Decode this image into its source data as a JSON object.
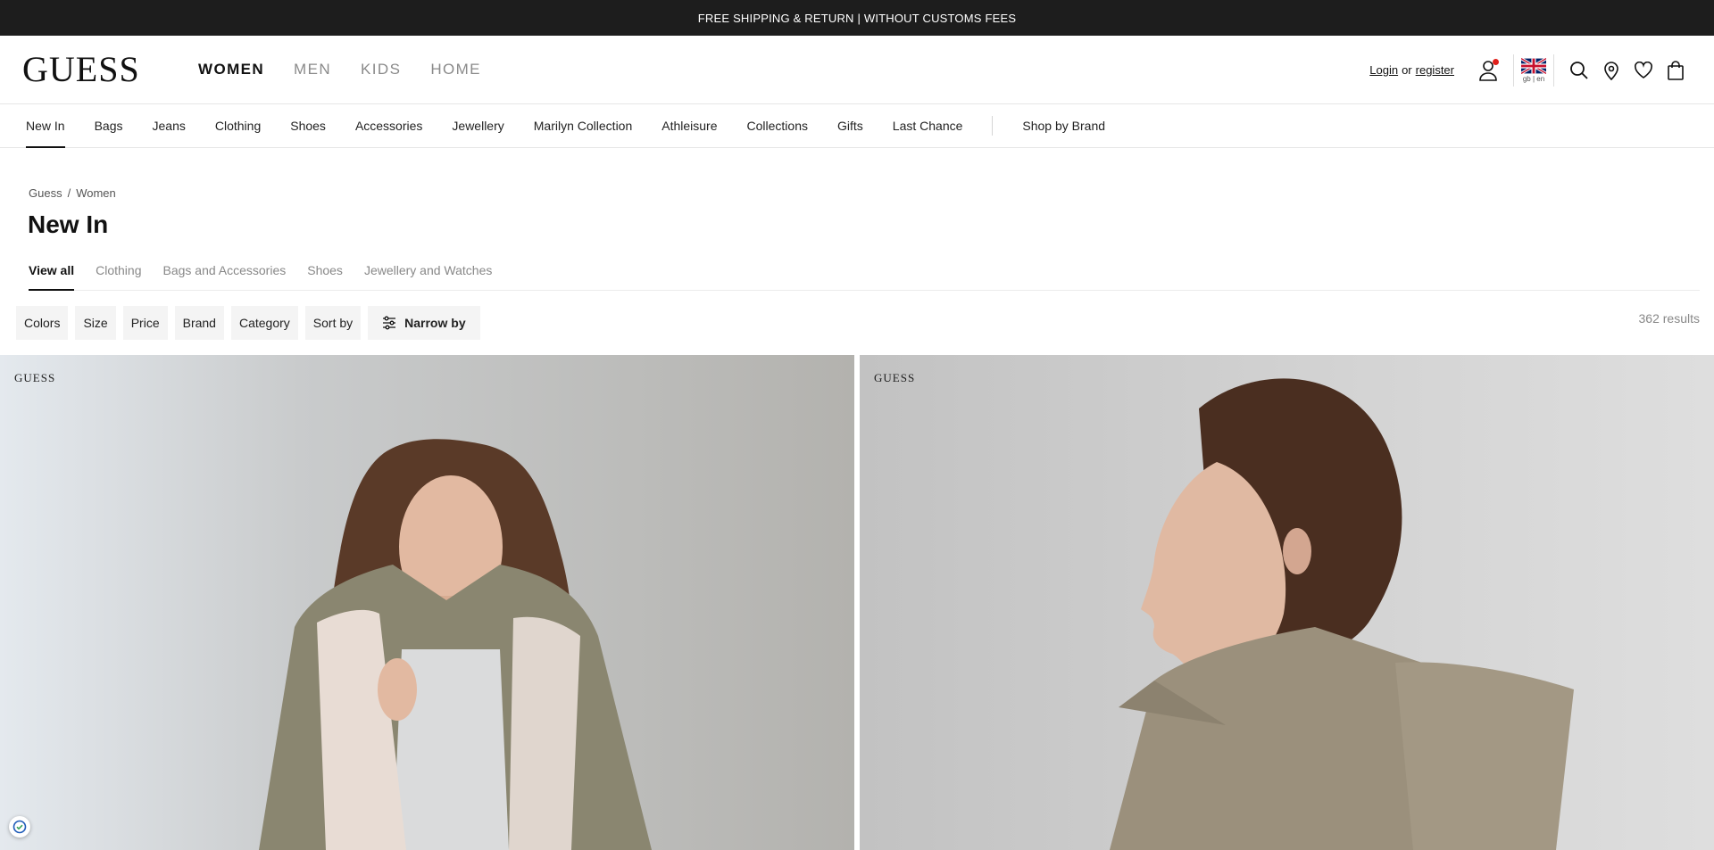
{
  "topbar": {
    "text": "FREE SHIPPING & RETURN | WITHOUT CUSTOMS FEES"
  },
  "header": {
    "logo": "GUESS",
    "main_nav": [
      "WOMEN",
      "MEN",
      "KIDS",
      "HOME"
    ],
    "login": {
      "login_label": "Login",
      "or": "or",
      "register_label": "register"
    },
    "locale": "gb | en"
  },
  "subnav": {
    "items": [
      "New In",
      "Bags",
      "Jeans",
      "Clothing",
      "Shoes",
      "Accessories",
      "Jewellery",
      "Marilyn Collection",
      "Athleisure",
      "Collections",
      "Gifts",
      "Last Chance"
    ],
    "shop_by_brand": "Shop by Brand"
  },
  "breadcrumb": [
    "Guess",
    "/",
    "Women"
  ],
  "page_title": "New In",
  "category_tabs": [
    "View all",
    "Clothing",
    "Bags and Accessories",
    "Shoes",
    "Jewellery and Watches"
  ],
  "filters": [
    "Colors",
    "Size",
    "Price",
    "Brand",
    "Category",
    "Sort by"
  ],
  "narrow_by": "Narrow by",
  "results": "362 results",
  "products": [
    {
      "brand": "GUESS"
    },
    {
      "brand": "GUESS"
    }
  ],
  "colors": {
    "topbar_bg": "#1d1d1d",
    "notification_dot": "#e0201b"
  }
}
